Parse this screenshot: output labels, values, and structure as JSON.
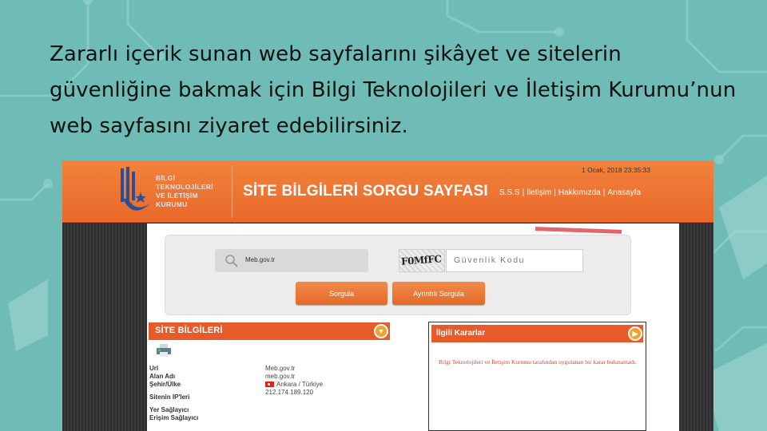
{
  "headline": "Zararlı içerik sunan web sayfalarını şikâyet ve sitelerin güvenliğine bakmak için Bilgi Teknolojileri ve İletişim Kurumu’nun web sayfasını ziyaret edebilirsiniz.",
  "site": {
    "logo_lines": [
      "BİLGİ",
      "TEKNOLOJİLERİ",
      "VE İLETİŞİM",
      "KURUMU"
    ],
    "title": "SİTE BİLGİLERİ SORGU SAYFASI",
    "timestamp": "1 Ocak, 2018 23:35:33",
    "nav": [
      "S.S.S",
      "İletişim",
      "Hakkımızda",
      "Anasayfa"
    ],
    "colors": {
      "header": "#ee7433",
      "accent": "#e75a2a",
      "background": "#6fbcb6"
    }
  },
  "search": {
    "icon": "search-icon",
    "value": "Meb.gov.tr",
    "captcha_text": "F0MfFC",
    "captcha_placeholder": "Güvenlik Kodu",
    "buttons": {
      "query": "Sorgula",
      "detailed_query": "Ayrıntılı Sorgula"
    }
  },
  "site_info": {
    "title": "SİTE BİLGİLERİ",
    "rows": [
      {
        "label": "Url",
        "value": "Meb.gov.tr"
      },
      {
        "label": "Alan Adı",
        "value": "meb.gov.tr"
      },
      {
        "label": "Şehir/Ülke",
        "value": "Ankara / Türkiye"
      },
      {
        "label": "Sitenin IP'leri",
        "value": "212.174.189.120"
      },
      {
        "label": "Yer Sağlayıcı",
        "value": ""
      },
      {
        "label": "Erişim Sağlayıcı",
        "value": ""
      }
    ]
  },
  "decisions": {
    "title": "İlgili Kararlar",
    "message": "Bilgi Teknolojileri ve İletişim Kurumu tarafından uygulanan bir karar bulunamadı."
  }
}
